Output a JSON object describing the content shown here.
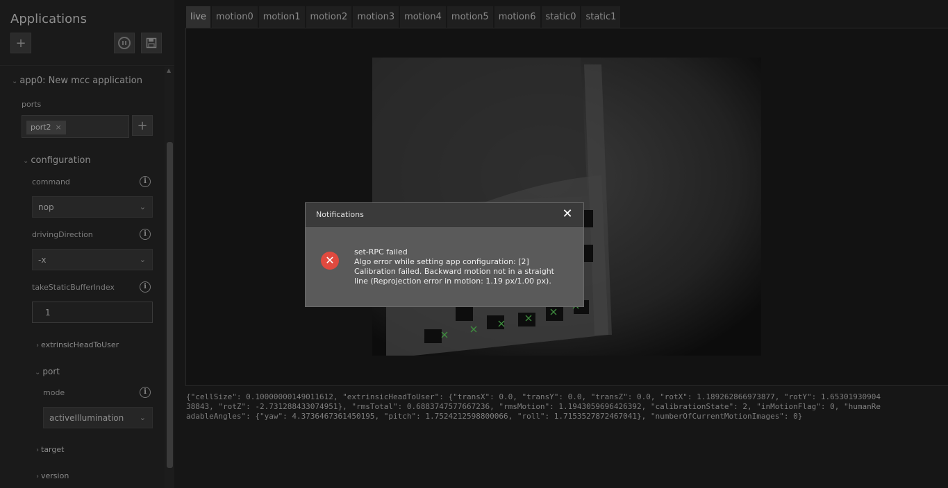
{
  "sidebar": {
    "title": "Applications",
    "add_icon": "plus-icon",
    "pause_icon": "pause-circle-icon",
    "save_icon": "floppy-disk-icon",
    "app_node": "app0: New mcc application",
    "ports_label": "ports",
    "port_tag": "port2",
    "port_tag_remove": "×",
    "configuration_label": "configuration",
    "command_label": "command",
    "command_value": "nop",
    "driving_direction_label": "drivingDirection",
    "driving_direction_value": "-x",
    "take_static_label": "takeStaticBufferIndex",
    "take_static_value": "1",
    "extrinsic_label": "extrinsicHeadToUser",
    "port_label": "port",
    "mode_label": "mode",
    "mode_value": "activeIllumination",
    "target_label": "target",
    "version_label": "version"
  },
  "tabs": [
    {
      "label": "live",
      "active": true
    },
    {
      "label": "motion0"
    },
    {
      "label": "motion1"
    },
    {
      "label": "motion2"
    },
    {
      "label": "motion3"
    },
    {
      "label": "motion4"
    },
    {
      "label": "motion5"
    },
    {
      "label": "motion6"
    },
    {
      "label": "static0"
    },
    {
      "label": "static1"
    }
  ],
  "status_json": "{\"cellSize\": 0.10000000149011612, \"extrinsicHeadToUser\": {\"transX\": 0.0, \"transY\": 0.0, \"transZ\": 0.0, \"rotX\": 1.189262866973877, \"rotY\": 1.6530193090438843, \"rotZ\": -2.731288433074951}, \"rmsTotal\": 0.6883747577667236, \"rmsMotion\": 1.194305969642639​2, \"calibrationState\": 2, \"inMotionFlag\": 0, \"humanReadableAngles\": {\"yaw\": 4.3736467361450195, \"pitch\": 1.7524212598800066, \"roll\": 1.7153527872467041}, \"numberOfCurrentMotionImages\": 0}",
  "dialog": {
    "title": "Notifications",
    "close_icon": "close-icon",
    "error_icon": "error-circle-icon",
    "message_title": "set-RPC failed",
    "message_body": "Algo error while setting app configuration: [2] Calibration failed. Backward motion not in a straight line (Reprojection error in motion: 1.19 px/1.00 px)."
  },
  "colors": {
    "error": "#e04a3f",
    "background": "#161616"
  }
}
